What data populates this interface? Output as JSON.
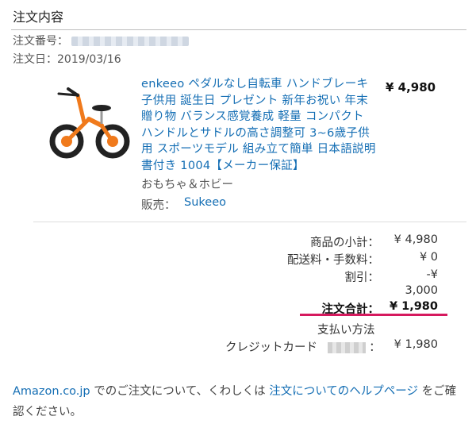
{
  "section": {
    "title": "注文内容"
  },
  "order": {
    "number_label": "注文番号：",
    "date_label": "注文日：",
    "date_value": "2019/03/16"
  },
  "product": {
    "title": "enkeeo ペダルなし自転車 ハンドブレーキ子供用 誕生日 プレゼント 新年お祝い 年末贈り物 バランス感覚養成 軽量 コンパクト ハンドルとサドルの高さ調整可 3~6歳子供用 スポーツモデル 組み立て簡単 日本語説明書付き 1004【メーカー保証】",
    "price": "¥ 4,980",
    "category": "おもちゃ＆ホビー",
    "seller_label": "販売：",
    "seller_name": "Sukeeo",
    "image_alt": "orange balance bike"
  },
  "summary": {
    "subtotal_label": "商品の小計：",
    "subtotal_value": "¥ 4,980",
    "shipping_label": "配送料・手数料：",
    "shipping_value": "¥ 0",
    "discount_label": "割引：",
    "discount_value_line1": "-¥",
    "discount_value_line2": "3,000",
    "total_label": "注文合計：",
    "total_value": "¥ 1,980",
    "payment_label": "支払い方法",
    "card_label": "クレジットカード",
    "card_colon": "：",
    "card_value": "¥ 1,980"
  },
  "footer": {
    "link1": "Amazon.co.jp",
    "text1": " でのご注文について、くわしくは ",
    "link2": "注文についてのヘルプページ",
    "text2": " をご確認ください。"
  },
  "colors": {
    "link": "#146eb4",
    "total_underline": "#d6195e",
    "bike_frame": "#f07a1c"
  }
}
